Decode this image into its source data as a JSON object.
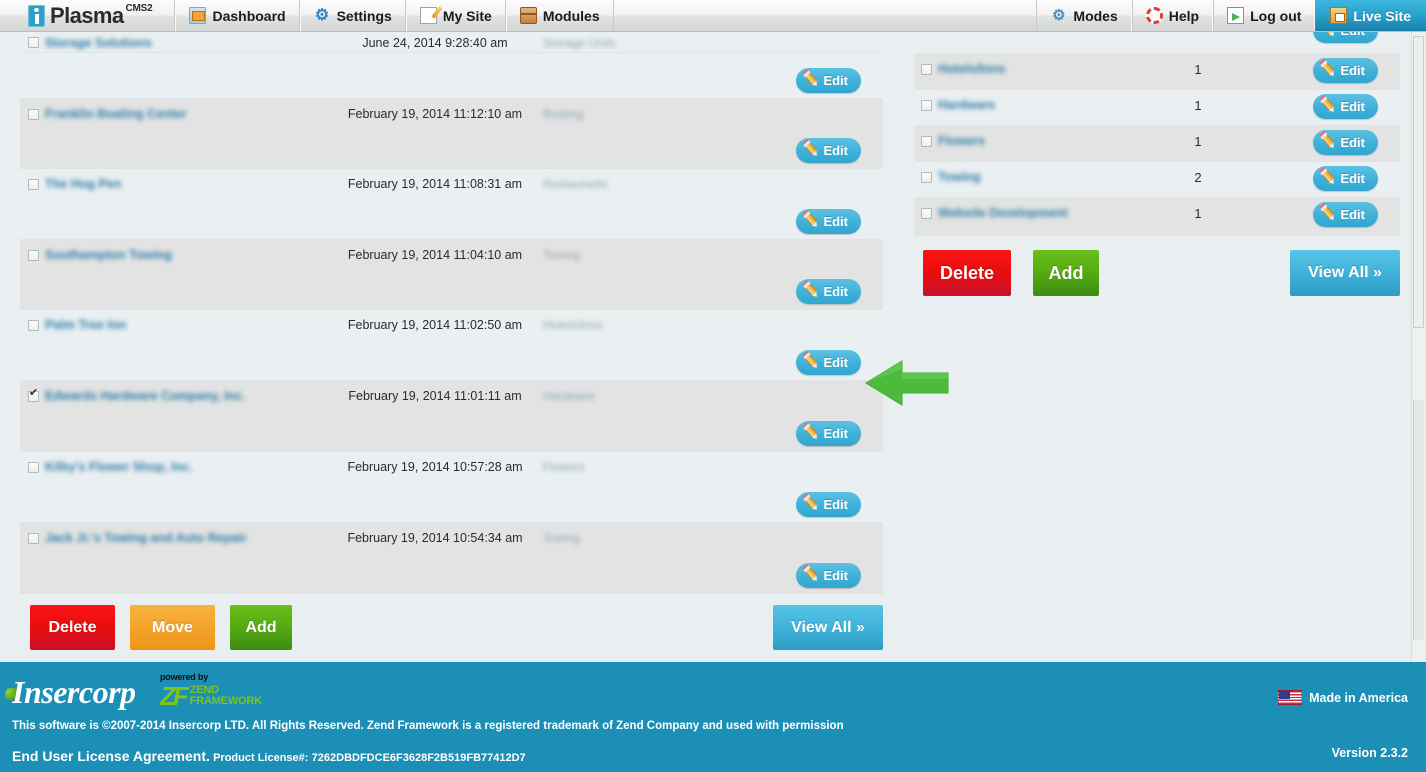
{
  "app": {
    "brand_name": "Plasma",
    "brand_sup": "CMS2",
    "version_label": "Version 2.3.2"
  },
  "nav": {
    "left_items": [
      {
        "label": "Dashboard",
        "icon": "home-icon"
      },
      {
        "label": "Settings",
        "icon": "gear-icon"
      },
      {
        "label": "My Site",
        "icon": "pencil-note-icon"
      },
      {
        "label": "Modules",
        "icon": "box-icon"
      }
    ],
    "right_items": [
      {
        "label": "Modes",
        "icon": "gears-icon"
      },
      {
        "label": "Help",
        "icon": "lifering-icon"
      },
      {
        "label": "Log out",
        "icon": "exit-door-icon"
      },
      {
        "label": "Live Site",
        "icon": "house-icon",
        "active": true
      }
    ]
  },
  "listings_table": {
    "edit_label": "Edit",
    "rows": [
      {
        "name": "Storage Solutions",
        "date": "June 24, 2014 9:28:40 am",
        "category": "Storage Units",
        "checked": false,
        "clipped": true
      },
      {
        "name": "Franklin Boating Center",
        "date": "February 19, 2014 11:12:10 am",
        "category": "Boating",
        "checked": false
      },
      {
        "name": "The Hog Pen",
        "date": "February 19, 2014 11:08:31 am",
        "category": "Restaurants",
        "checked": false
      },
      {
        "name": "Southampton Towing",
        "date": "February 19, 2014 11:04:10 am",
        "category": "Towing",
        "checked": false
      },
      {
        "name": "Palm Tree Inn",
        "date": "February 19, 2014 11:02:50 am",
        "category": "Hotels/Inns",
        "checked": false
      },
      {
        "name": "Edwards Hardware Company, Inc.",
        "date": "February 19, 2014 11:01:11 am",
        "category": "Hardware",
        "checked": true
      },
      {
        "name": "Kilby's Flower Shop, Inc.",
        "date": "February 19, 2014 10:57:28 am",
        "category": "Flowers",
        "checked": false
      },
      {
        "name": "Jack Jr.'s Towing and Auto Repair",
        "date": "February 19, 2014 10:54:34 am",
        "category": "Towing",
        "checked": false
      }
    ],
    "buttons": {
      "delete": "Delete",
      "move": "Move",
      "add": "Add",
      "view_all": "View All »"
    }
  },
  "categories_table": {
    "edit_label": "Edit",
    "rows": [
      {
        "name": "",
        "count": "",
        "checked": false,
        "clipped": true
      },
      {
        "name": "Hotels/Inns",
        "count": "1",
        "checked": false
      },
      {
        "name": "Hardware",
        "count": "1",
        "checked": false
      },
      {
        "name": "Flowers",
        "count": "1",
        "checked": false
      },
      {
        "name": "Towing",
        "count": "2",
        "checked": false
      },
      {
        "name": "Website Development",
        "count": "1",
        "checked": false
      }
    ],
    "buttons": {
      "delete": "Delete",
      "add": "Add",
      "view_all": "View All »"
    }
  },
  "annotation": {
    "arrow_color": "#4cbb3c",
    "points_at": "Edit"
  },
  "footer": {
    "company": "Insercorp",
    "powered_by": "powered by",
    "zend_zf": "ZF",
    "zend_line1": "ZEND",
    "zend_line2": "FRAMEWORK",
    "copyright": "This software is ©2007-2014 Insercorp LTD. All Rights Reserved. Zend Framework is a registered trademark of Zend Company and used with permission",
    "eula_label": "End User License Agreement.",
    "license_label": "Product License#:",
    "license_key": "7262DBDFDCE6F3628F2B519FB77412D7",
    "made_in": "Made in America",
    "version": "Version 2.3.2"
  },
  "theme": {
    "accent_blue": "#34a6d0",
    "footer_blue": "#1b8fb5",
    "red": "#ea0d0d",
    "orange": "#f4a42a",
    "green": "#57ad12"
  }
}
